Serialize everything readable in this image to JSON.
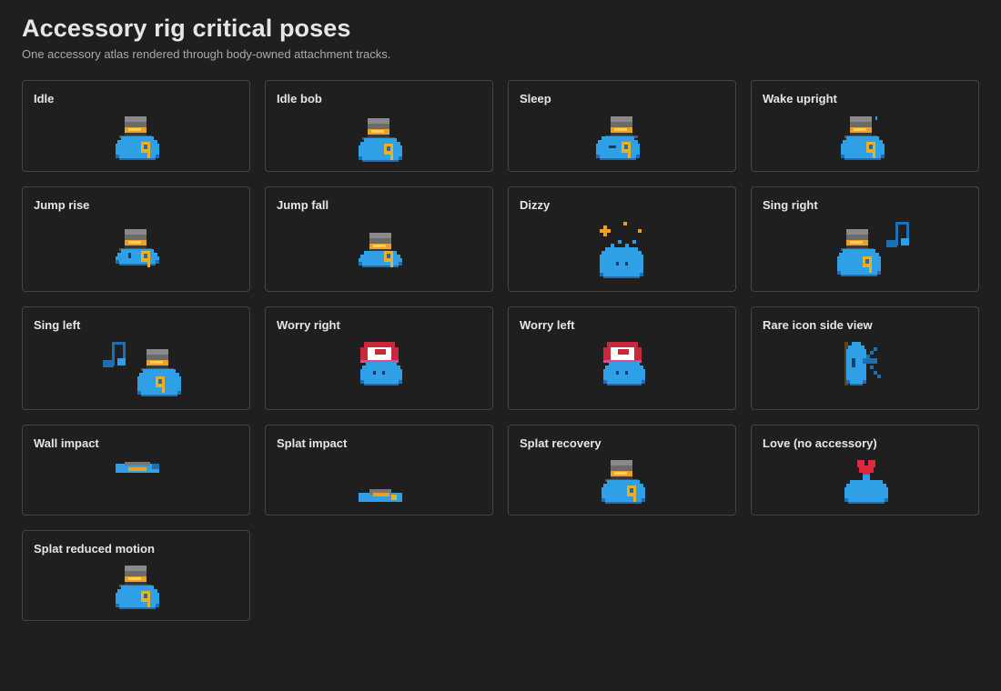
{
  "page": {
    "title": "Accessory rig critical poses",
    "subtitle": "One accessory atlas rendered through body-owned attachment tracks."
  },
  "colors": {
    "background": "#1f1f1f",
    "card_border": "#444444",
    "slime_blue": "#2f9fe6",
    "slime_dark": "#1a6fb5",
    "hat_gray": "#6b6b6b",
    "hat_band": "#f0a020",
    "key_gold": "#e8b02a",
    "cap_red": "#c8283c",
    "heart_red": "#e0283c"
  },
  "poses": [
    {
      "label": "Idle",
      "icon": "slime-top-hat-key-icon"
    },
    {
      "label": "Idle bob",
      "icon": "slime-top-hat-key-icon"
    },
    {
      "label": "Sleep",
      "icon": "slime-top-hat-key-icon"
    },
    {
      "label": "Wake upright",
      "icon": "slime-top-hat-key-icon"
    },
    {
      "label": "Jump rise",
      "icon": "slime-top-hat-key-icon"
    },
    {
      "label": "Jump fall",
      "icon": "slime-top-hat-key-icon"
    },
    {
      "label": "Dizzy",
      "icon": "slime-dizzy-stars-icon"
    },
    {
      "label": "Sing right",
      "icon": "slime-sing-note-icon"
    },
    {
      "label": "Sing left",
      "icon": "slime-sing-note-icon"
    },
    {
      "label": "Worry right",
      "icon": "slime-red-cap-icon"
    },
    {
      "label": "Worry left",
      "icon": "slime-red-cap-icon"
    },
    {
      "label": "Rare icon side view",
      "icon": "slime-side-view-icon"
    },
    {
      "label": "Wall impact",
      "icon": "slime-wall-squash-icon"
    },
    {
      "label": "Splat impact",
      "icon": "slime-splat-icon"
    },
    {
      "label": "Splat recovery",
      "icon": "slime-top-hat-key-icon"
    },
    {
      "label": "Love (no accessory)",
      "icon": "slime-heart-icon"
    },
    {
      "label": "Splat reduced motion",
      "icon": "slime-top-hat-key-icon"
    }
  ]
}
